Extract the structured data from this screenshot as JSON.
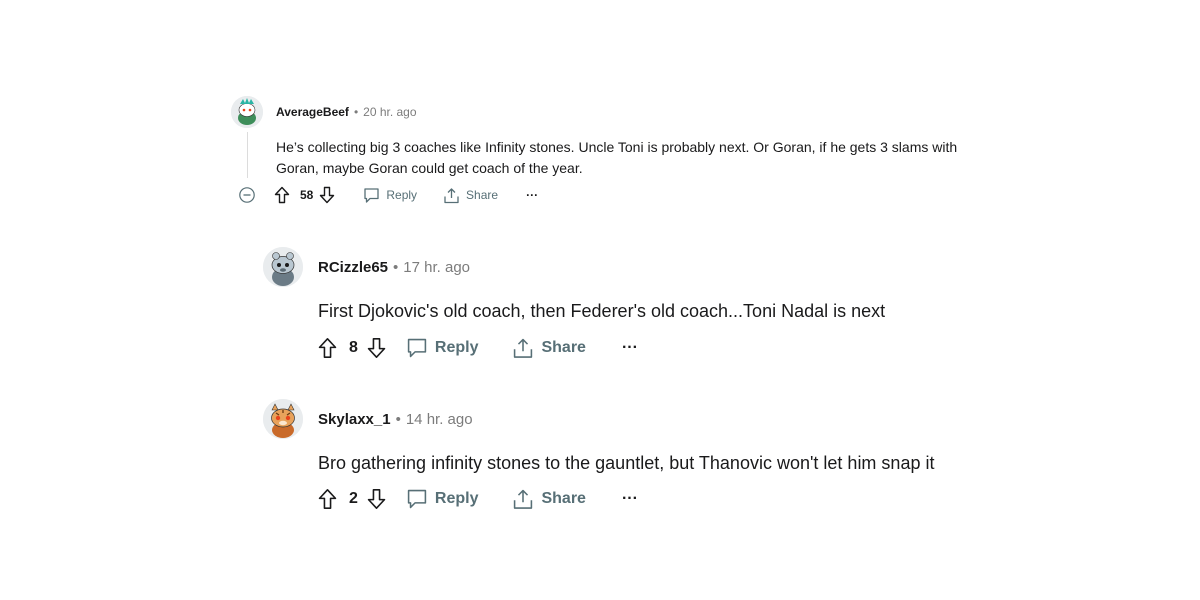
{
  "comments": [
    {
      "username": "AverageBeef",
      "separator": "•",
      "time": "20 hr. ago",
      "body": "He’s collecting big 3 coaches like Infinity stones. Uncle Toni is probably next. Or Goran, if he gets 3 slams with Goran, maybe Goran could get coach of the year.",
      "votes": "58",
      "reply_label": "Reply",
      "share_label": "Share",
      "more_label": "···"
    },
    {
      "username": "RCizzle65",
      "separator": "•",
      "time": "17 hr. ago",
      "body": "First Djokovic's old coach, then Federer's old coach...Toni Nadal is next",
      "votes": "8",
      "reply_label": "Reply",
      "share_label": "Share",
      "more_label": "···"
    },
    {
      "username": "Skylaxx_1",
      "separator": "•",
      "time": "14 hr. ago",
      "body": "Bro gathering infinity stones to the gauntlet, but Thanovic won't let him snap it",
      "votes": "2",
      "reply_label": "Reply",
      "share_label": "Share",
      "more_label": "···"
    }
  ],
  "icons": {
    "collapse": "collapse-minus-icon",
    "upvote": "upvote-arrow-icon",
    "downvote": "downvote-arrow-icon",
    "reply": "speech-bubble-icon",
    "share": "share-arrow-icon",
    "more": "ellipsis-icon"
  },
  "colors": {
    "text": "#1a1a1b",
    "muted": "#7c7c7c",
    "action": "#576f76",
    "thread_line": "#dcdcdc"
  }
}
